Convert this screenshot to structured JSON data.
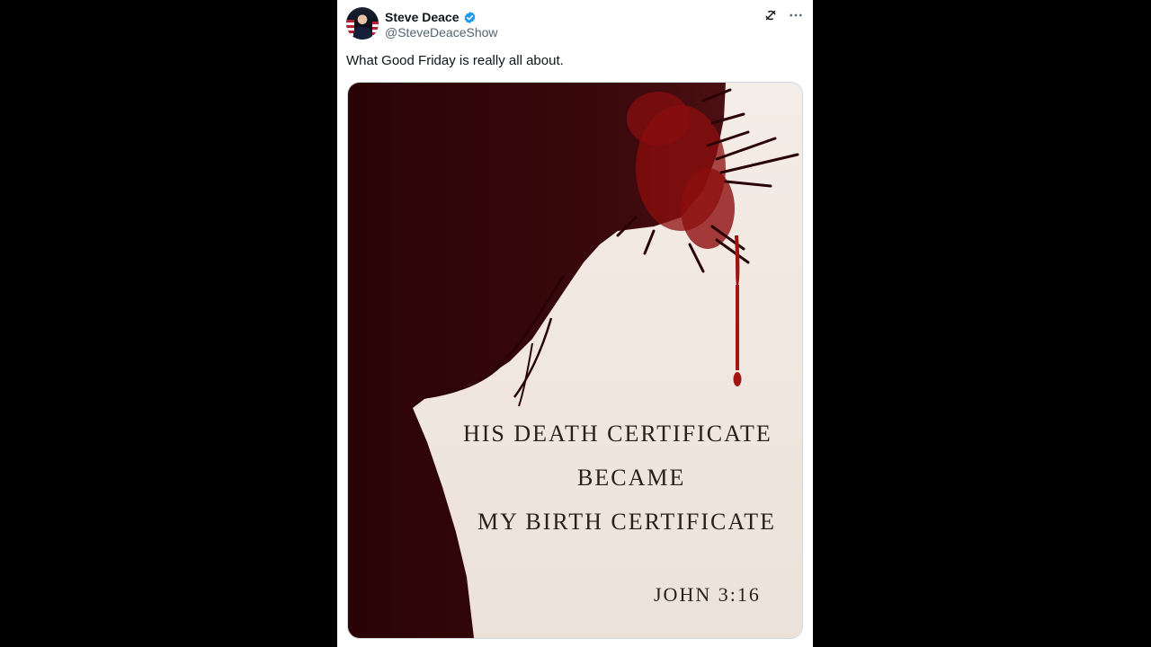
{
  "author": {
    "display_name": "Steve Deace",
    "handle": "@SteveDeaceShow",
    "verified": true,
    "verified_color": "#1d9bf0"
  },
  "icons": {
    "grok": "grok-icon",
    "more": "more-options-icon"
  },
  "tweet": {
    "text": "What Good Friday is really all about."
  },
  "media": {
    "line1": "HIS DEATH CERTIFICATE",
    "line2": "BECAME",
    "line3": "MY BIRTH CERTIFICATE",
    "verse": "JOHN 3:16",
    "colors": {
      "silhouette": "#2b0608",
      "blood": "#b0140f",
      "background": "#f2e9e1"
    }
  }
}
